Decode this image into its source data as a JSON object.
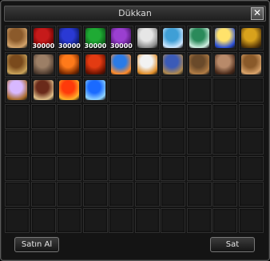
{
  "window": {
    "title": "Dükkan",
    "close_label": "✕"
  },
  "items": [
    {
      "icon": "staff-icon",
      "colors": [
        "#8b5a2b",
        "#d2a36b"
      ]
    },
    {
      "icon": "red-potion-icon",
      "price": "30000",
      "colors": [
        "#c61a1a",
        "#6a0000"
      ]
    },
    {
      "icon": "blue-potion-icon",
      "price": "30000",
      "colors": [
        "#2a39d4",
        "#0b1866"
      ]
    },
    {
      "icon": "green-potion-icon",
      "price": "30000",
      "colors": [
        "#1faa34",
        "#0b5a17"
      ]
    },
    {
      "icon": "purple-potion-icon",
      "price": "30000",
      "colors": [
        "#9a3fd0",
        "#4b136b"
      ]
    },
    {
      "icon": "fish-bone-icon",
      "colors": [
        "#e6e6e6",
        "#8a8a8a"
      ]
    },
    {
      "icon": "magic-wand-icon",
      "colors": [
        "#3f9fd6",
        "#cfe8ff"
      ]
    },
    {
      "icon": "green-wand-icon",
      "colors": [
        "#2a8a5a",
        "#cfeee0"
      ]
    },
    {
      "icon": "blue-flame-icon",
      "colors": [
        "#ffe26b",
        "#2a4fd6"
      ]
    },
    {
      "icon": "gold-ring-icon",
      "colors": [
        "#d8a21c",
        "#5b3a08"
      ]
    },
    {
      "icon": "scroll-bundle-icon",
      "colors": [
        "#7a4a1c",
        "#c9a35a"
      ]
    },
    {
      "icon": "sack-icon",
      "colors": [
        "#9c7f66",
        "#4d3b2f"
      ]
    },
    {
      "icon": "orange-potion-icon",
      "colors": [
        "#ff7a1a",
        "#7a2a00"
      ]
    },
    {
      "icon": "orange-red-potion-icon",
      "colors": [
        "#e33b12",
        "#6a1200"
      ]
    },
    {
      "icon": "blue-orange-potion-icon",
      "colors": [
        "#2b7be6",
        "#ff8b2a"
      ]
    },
    {
      "icon": "white-potion-icon",
      "colors": [
        "#f2f2f2",
        "#e08e2a"
      ]
    },
    {
      "icon": "card-icon",
      "colors": [
        "#3b5bb8",
        "#b18a4f"
      ]
    },
    {
      "icon": "book-icon",
      "colors": [
        "#6a4a2a",
        "#b07c45"
      ]
    },
    {
      "icon": "mask-icon",
      "colors": [
        "#b88a6a",
        "#4a2a1a"
      ]
    },
    {
      "icon": "hat-icon",
      "colors": [
        "#8a5a2a",
        "#d9a36a"
      ]
    },
    {
      "icon": "feather-pen-icon",
      "colors": [
        "#d8b8ff",
        "#a86a2a"
      ]
    },
    {
      "icon": "claw-icon",
      "colors": [
        "#6a2a1a",
        "#e0c08a"
      ]
    },
    {
      "icon": "fire-elixir-icon",
      "colors": [
        "#ff3a0a",
        "#ffb22a"
      ]
    },
    {
      "icon": "ice-elixir-icon",
      "colors": [
        "#1a6aff",
        "#8fd2ff"
      ]
    }
  ],
  "buttons": {
    "buy": "Satın Al",
    "sell": "Sat"
  }
}
